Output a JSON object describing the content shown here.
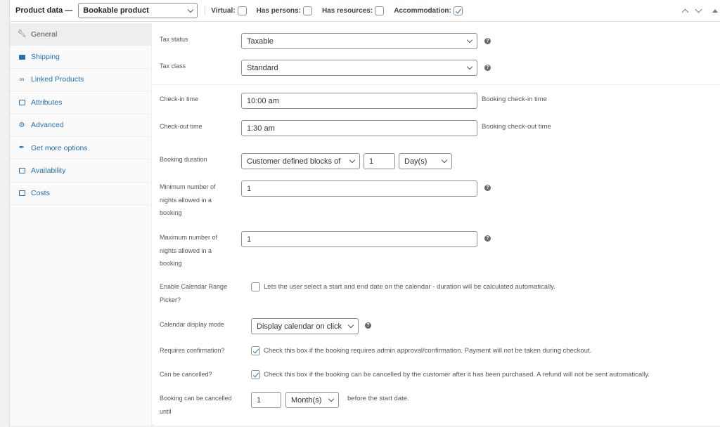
{
  "header": {
    "title": "Product data —",
    "product_type": "Bookable product",
    "options": [
      {
        "label": "Virtual:",
        "checked": false
      },
      {
        "label": "Has persons:",
        "checked": false
      },
      {
        "label": "Has resources:",
        "checked": false
      },
      {
        "label": "Accommodation:",
        "checked": true
      }
    ]
  },
  "sidebar": {
    "items": [
      {
        "label": "General",
        "icon": "wrench-icon",
        "active": true
      },
      {
        "label": "Shipping",
        "icon": "truck-icon",
        "active": false
      },
      {
        "label": "Linked Products",
        "icon": "link-icon",
        "active": false
      },
      {
        "label": "Attributes",
        "icon": "list-icon",
        "active": false
      },
      {
        "label": "Advanced",
        "icon": "gear-icon",
        "active": false
      },
      {
        "label": "Get more options",
        "icon": "plugin-icon",
        "active": false
      },
      {
        "label": "Availability",
        "icon": "calendar-icon",
        "active": false
      },
      {
        "label": "Costs",
        "icon": "costs-icon",
        "active": false
      }
    ]
  },
  "general": {
    "tax_status": {
      "label": "Tax status",
      "value": "Taxable"
    },
    "tax_class": {
      "label": "Tax class",
      "value": "Standard"
    },
    "check_in": {
      "label": "Check-in time",
      "value": "10:00 am",
      "desc": "Booking check-in time"
    },
    "check_out": {
      "label": "Check-out time",
      "value": "1:30 am",
      "desc": "Booking check-out time"
    },
    "booking_duration": {
      "label": "Booking duration",
      "type": "Customer defined blocks of",
      "amount": "1",
      "unit": "Day(s)"
    },
    "min_nights": {
      "label": "Minimum number of nights allowed in a booking",
      "value": "1"
    },
    "max_nights": {
      "label": "Maximum number of nights allowed in a booking",
      "value": "1"
    },
    "range_picker": {
      "label": "Enable Calendar Range Picker?",
      "checked": false,
      "desc": "Lets the user select a start and end date on the calendar - duration will be calculated automatically."
    },
    "calendar_mode": {
      "label": "Calendar display mode",
      "value": "Display calendar on click"
    },
    "requires_confirmation": {
      "label": "Requires confirmation?",
      "checked": true,
      "desc": "Check this box if the booking requires admin approval/confirmation. Payment will not be taken during checkout."
    },
    "can_cancel": {
      "label": "Can be cancelled?",
      "checked": true,
      "desc": "Check this box if the booking can be cancelled by the customer after it has been purchased. A refund will not be sent automatically."
    },
    "cancel_until": {
      "label": "Booking can be cancelled until",
      "amount": "1",
      "unit": "Month(s)",
      "desc": "before the start date."
    }
  },
  "help_icon": "?"
}
